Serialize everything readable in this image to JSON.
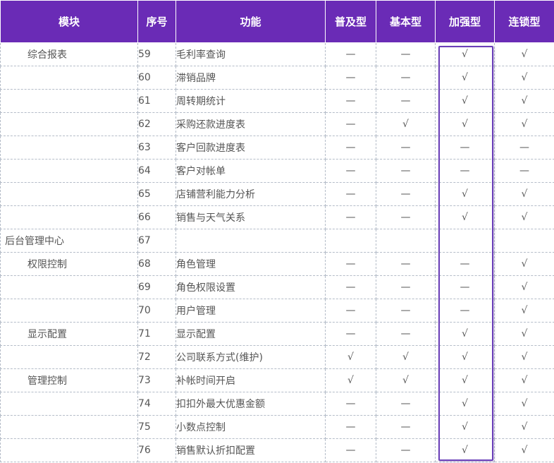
{
  "headers": {
    "module": "模块",
    "num": "序号",
    "func": "功能",
    "basic_popular": "普及型",
    "basic": "基本型",
    "enhanced": "加强型",
    "chain": "连锁型"
  },
  "rows": [
    {
      "module": "综合报表",
      "indent": 1,
      "num": "59",
      "func": "毛利率查询",
      "c1": "—",
      "c2": "—",
      "c3": "√",
      "c4": "√"
    },
    {
      "module": "",
      "indent": 1,
      "num": "60",
      "func": "滞销品牌",
      "c1": "—",
      "c2": "—",
      "c3": "√",
      "c4": "√"
    },
    {
      "module": "",
      "indent": 1,
      "num": "61",
      "func": "周转期统计",
      "c1": "—",
      "c2": "—",
      "c3": "√",
      "c4": "√"
    },
    {
      "module": "",
      "indent": 1,
      "num": "62",
      "func": "采购还款进度表",
      "c1": "—",
      "c2": "√",
      "c3": "√",
      "c4": "√"
    },
    {
      "module": "",
      "indent": 1,
      "num": "63",
      "func": "客户回款进度表",
      "c1": "—",
      "c2": "—",
      "c3": "—",
      "c4": "—"
    },
    {
      "module": "",
      "indent": 1,
      "num": "64",
      "func": "客户对帐单",
      "c1": "—",
      "c2": "—",
      "c3": "—",
      "c4": "—"
    },
    {
      "module": "",
      "indent": 1,
      "num": "65",
      "func": "店铺营利能力分析",
      "c1": "—",
      "c2": "—",
      "c3": "√",
      "c4": "√"
    },
    {
      "module": "",
      "indent": 1,
      "num": "66",
      "func": "销售与天气关系",
      "c1": "—",
      "c2": "—",
      "c3": "√",
      "c4": "√"
    },
    {
      "module": "后台管理中心",
      "indent": 0,
      "num": "67",
      "func": "",
      "c1": "",
      "c2": "",
      "c3": "",
      "c4": ""
    },
    {
      "module": "权限控制",
      "indent": 1,
      "num": "68",
      "func": "角色管理",
      "c1": "—",
      "c2": "—",
      "c3": "—",
      "c4": "√"
    },
    {
      "module": "",
      "indent": 1,
      "num": "69",
      "func": "角色权限设置",
      "c1": "—",
      "c2": "—",
      "c3": "—",
      "c4": "√"
    },
    {
      "module": "",
      "indent": 1,
      "num": "70",
      "func": "用户管理",
      "c1": "—",
      "c2": "—",
      "c3": "—",
      "c4": "√"
    },
    {
      "module": "显示配置",
      "indent": 1,
      "num": "71",
      "func": "显示配置",
      "c1": "—",
      "c2": "—",
      "c3": "√",
      "c4": "√"
    },
    {
      "module": "",
      "indent": 1,
      "num": "72",
      "func": "公司联系方式(维护)",
      "c1": "√",
      "c2": "√",
      "c3": "√",
      "c4": "√"
    },
    {
      "module": "管理控制",
      "indent": 1,
      "num": "73",
      "func": "补帐时间开启",
      "c1": "√",
      "c2": "√",
      "c3": "√",
      "c4": "√"
    },
    {
      "module": "",
      "indent": 1,
      "num": "74",
      "func": "扣扣外最大优惠金额",
      "c1": "—",
      "c2": "—",
      "c3": "√",
      "c4": "√"
    },
    {
      "module": "",
      "indent": 1,
      "num": "75",
      "func": "小数点控制",
      "c1": "—",
      "c2": "—",
      "c3": "√",
      "c4": "√"
    },
    {
      "module": "",
      "indent": 1,
      "num": "76",
      "func": "销售默认折扣配置",
      "c1": "—",
      "c2": "—",
      "c3": "√",
      "c4": "√"
    }
  ],
  "colors": {
    "header_bg": "#6a2bb6",
    "header_text": "#ffffff",
    "highlight_border": "#6a3fb8",
    "grid_line": "#b4bcc8"
  }
}
